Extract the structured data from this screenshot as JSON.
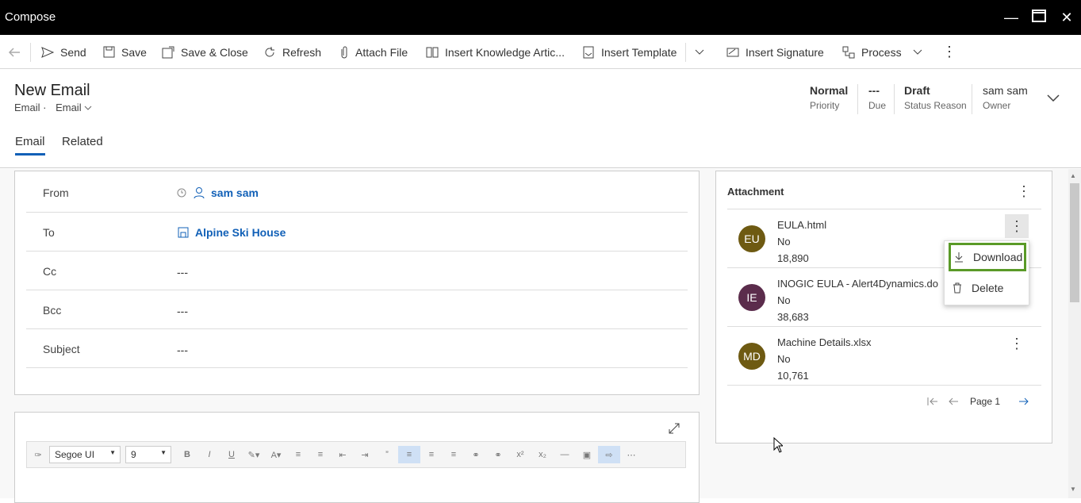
{
  "window": {
    "title": "Compose"
  },
  "toolbar": {
    "send": "Send",
    "save": "Save",
    "save_close": "Save & Close",
    "refresh": "Refresh",
    "attach_file": "Attach File",
    "insert_knowledge": "Insert Knowledge Artic...",
    "insert_template": "Insert Template",
    "insert_signature": "Insert Signature",
    "process": "Process"
  },
  "record": {
    "title": "New Email",
    "entity": "Email",
    "form": "Email",
    "fields": [
      {
        "value": "Normal",
        "label": "Priority"
      },
      {
        "value": "---",
        "label": "Due"
      },
      {
        "value": "Draft",
        "label": "Status Reason"
      },
      {
        "value": "sam sam",
        "label": "Owner"
      }
    ]
  },
  "tabs": [
    "Email",
    "Related"
  ],
  "form": {
    "from": {
      "label": "From",
      "value": "sam sam"
    },
    "to": {
      "label": "To",
      "value": "Alpine Ski House"
    },
    "cc": {
      "label": "Cc",
      "value": "---"
    },
    "bcc": {
      "label": "Bcc",
      "value": "---"
    },
    "subject": {
      "label": "Subject",
      "value": "---"
    }
  },
  "editor": {
    "font": "Segoe UI",
    "size": "9"
  },
  "attachments": {
    "title": "Attachment",
    "items": [
      {
        "initials": "EU",
        "name": "EULA.html",
        "flag": "No",
        "size": "18,890",
        "color": "#6e5a12"
      },
      {
        "initials": "IE",
        "name": "INOGIC EULA - Alert4Dynamics.do",
        "flag": "No",
        "size": "38,683",
        "color": "#5b2c4c"
      },
      {
        "initials": "MD",
        "name": "Machine Details.xlsx",
        "flag": "No",
        "size": "10,761",
        "color": "#6e5a12"
      }
    ],
    "page": "Page 1"
  },
  "context_menu": {
    "download": "Download",
    "delete": "Delete"
  },
  "colors": {
    "accent": "#1160b7",
    "highlight": "#5a9a28"
  }
}
